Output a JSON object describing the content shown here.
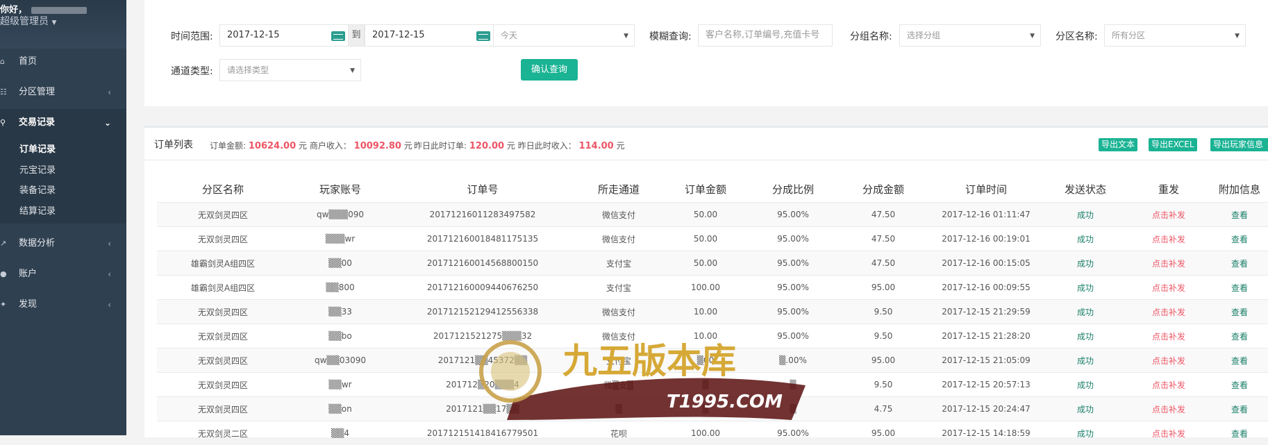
{
  "sidebar": {
    "greeting": "你好，",
    "role": "超级管理员",
    "items": [
      {
        "label": "首页"
      },
      {
        "label": "分区管理"
      },
      {
        "label": "交易记录"
      },
      {
        "label": "数据分析"
      },
      {
        "label": "账户"
      },
      {
        "label": "发现"
      }
    ],
    "subitems": [
      {
        "label": "订单记录"
      },
      {
        "label": "元宝记录"
      },
      {
        "label": "装备记录"
      },
      {
        "label": "结算记录"
      }
    ]
  },
  "filters": {
    "time_label": "时间范围:",
    "start_date": "2017-12-15",
    "to_label": "到",
    "end_date": "2017-12-15",
    "period_value": "今天",
    "fuzzy_label": "模糊查询:",
    "fuzzy_placeholder": "客户名称,订单编号,充值卡号",
    "group_label": "分组名称:",
    "group_value": "选择分组",
    "zone_label": "分区名称:",
    "zone_value": "所有分区",
    "channel_label": "通道类型:",
    "channel_value": "请选择类型",
    "query_button": "确认查询"
  },
  "orders": {
    "title": "订单列表",
    "amount_label": "订单金额:",
    "amount_value": "10624.00",
    "amount_unit": "元",
    "income_label": "商户收入：",
    "income_value": "10092.80",
    "income_unit": "元",
    "yesterday_label": "昨日此时订单:",
    "yesterday_value": "120.00",
    "yesterday_unit": "元",
    "yincome_label": "昨日此时收入：",
    "yincome_value": "114.00",
    "yincome_unit": "元",
    "export_text": "导出文本",
    "export_excel": "导出EXCEL",
    "export_players": "导出玩家信息",
    "columns": [
      "分区名称",
      "玩家账号",
      "订单号",
      "所走通道",
      "订单金额",
      "分成比例",
      "分成金额",
      "订单时间",
      "发送状态",
      "重发",
      "附加信息"
    ],
    "rows": [
      [
        "无双剑灵四区",
        "qw▒▒▒090",
        "20171216011283497582",
        "微信支付",
        "50.00",
        "95.00%",
        "47.50",
        "2017-12-16 01:11:47",
        "成功",
        "点击补发",
        "查看"
      ],
      [
        "无双剑灵四区",
        "▒▒▒wr",
        "20171216001848117513​5",
        "微信支付",
        "50.00",
        "95.00%",
        "47.50",
        "2017-12-16 00:19:01",
        "成功",
        "点击补发",
        "查看"
      ],
      [
        "雄霸剑灵A组四区",
        "▒▒00",
        "20171216001456880015​0",
        "支付宝",
        "50.00",
        "95.00%",
        "47.50",
        "2017-12-16 00:15:05",
        "成功",
        "点击补发",
        "查看"
      ],
      [
        "雄霸剑灵A组四区",
        "▒▒800",
        "20171216000944067625​0",
        "支付宝",
        "100.00",
        "95.00%",
        "95.00",
        "2017-12-16 00:09:55",
        "成功",
        "点击补发",
        "查看"
      ],
      [
        "无双剑灵四区",
        "▒▒33",
        "20171215212941255633​8",
        "微信支付",
        "10.00",
        "95.00%",
        "9.50",
        "2017-12-15 21:29:59",
        "成功",
        "点击补发",
        "查看"
      ],
      [
        "无双剑灵四区",
        "▒▒bo",
        "2017121521275▒▒▒32",
        "微信支付",
        "10.00",
        "95.00%",
        "9.50",
        "2017-12-15 21:28:20",
        "成功",
        "点击补发",
        "查看"
      ],
      [
        "无双剑灵四区",
        "qw▒▒03090",
        "2017121▒▒45372▒▒",
        "支付宝",
        "▒00",
        "▒.00%",
        "95.00",
        "2017-12-15 21:05:09",
        "成功",
        "点击补发",
        "查看"
      ],
      [
        "无双剑灵四区",
        "▒▒wr",
        "201712▒20▒▒▒4",
        "微▒支▒",
        "▒",
        "▒",
        "9.50",
        "2017-12-15 20:57:13",
        "成功",
        "点击补发",
        "查看"
      ],
      [
        "无双剑灵四区",
        "▒▒on",
        "2017121▒▒17▒▒",
        "▒",
        "▒",
        "▒",
        "4.75",
        "2017-12-15 20:24:47",
        "成功",
        "点击补发",
        "查看"
      ],
      [
        "无双剑灵二区",
        "▒▒4",
        "2017121514184​16779501",
        "花呗",
        "100.00",
        "95.00%",
        "95.00",
        "2017-12-15 14:18:59",
        "成功",
        "点击补发",
        "查看"
      ]
    ]
  },
  "watermark": {
    "brand": "九五版本库",
    "site": "T1995.COM"
  }
}
